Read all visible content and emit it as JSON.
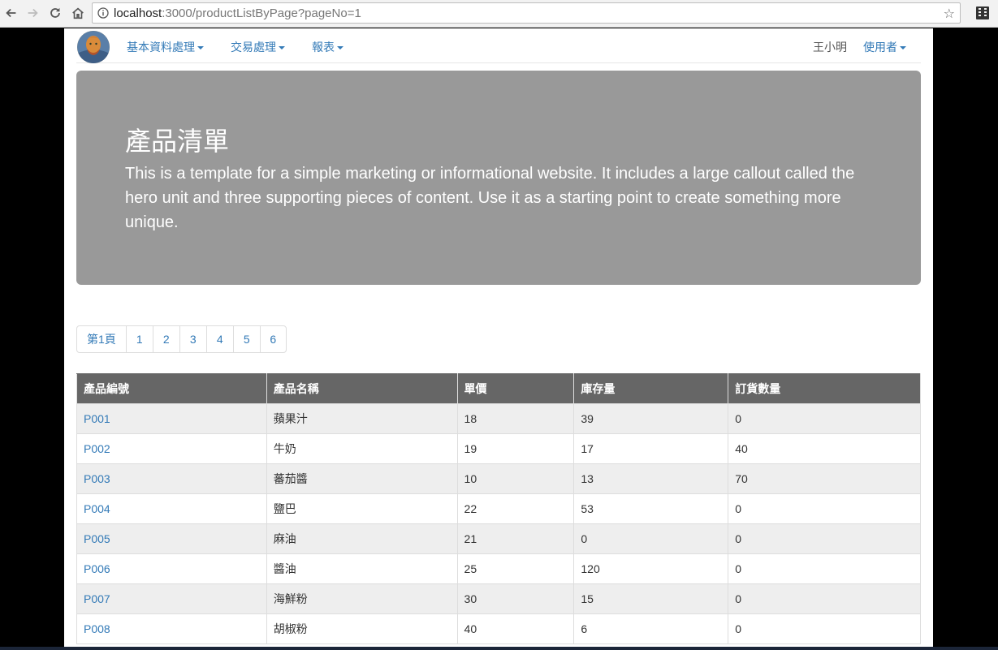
{
  "browser": {
    "url_host": "localhost",
    "url_path": ":3000/productListByPage?pageNo=1"
  },
  "navbar": {
    "menus": [
      "基本資料處理",
      "交易處理",
      "報表"
    ],
    "user_name": "王小明",
    "user_menu": "使用者"
  },
  "jumbotron": {
    "title": "產品清單",
    "text": "This is a template for a simple marketing or informational website. It includes a large callout called the hero unit and three supporting pieces of content. Use it as a starting point to create something more unique."
  },
  "pagination": {
    "first": "第1頁",
    "pages": [
      "1",
      "2",
      "3",
      "4",
      "5",
      "6"
    ]
  },
  "table": {
    "headers": [
      "產品編號",
      "產品名稱",
      "單價",
      "庫存量",
      "訂貨數量"
    ],
    "rows": [
      [
        "P001",
        "蘋果汁",
        "18",
        "39",
        "0"
      ],
      [
        "P002",
        "牛奶",
        "19",
        "17",
        "40"
      ],
      [
        "P003",
        "蕃茄醬",
        "10",
        "13",
        "70"
      ],
      [
        "P004",
        "鹽巴",
        "22",
        "53",
        "0"
      ],
      [
        "P005",
        "麻油",
        "21",
        "0",
        "0"
      ],
      [
        "P006",
        "醬油",
        "25",
        "120",
        "0"
      ],
      [
        "P007",
        "海鮮粉",
        "30",
        "15",
        "0"
      ],
      [
        "P008",
        "胡椒粉",
        "40",
        "6",
        "0"
      ]
    ]
  },
  "colors": {
    "link": "#337ab7",
    "jumbotron_bg": "#999999",
    "table_header_bg": "#666666"
  }
}
